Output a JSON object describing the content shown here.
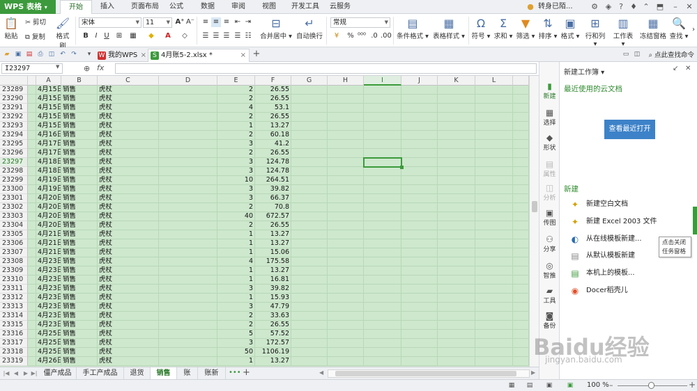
{
  "app": {
    "logo": "WPS 表格"
  },
  "menu_tabs": [
    "开始",
    "插入",
    "页面布局",
    "公式",
    "数据",
    "审阅",
    "视图",
    "开发工具",
    "云服务"
  ],
  "active_menu_tab": 0,
  "user": {
    "name": "转身已陌..."
  },
  "ribbon": {
    "paste": "粘贴",
    "cut": "剪切",
    "copy": "复制",
    "format_painter": "格式刷",
    "font_name": "宋体",
    "font_size": "11",
    "merge_center": "合并居中",
    "wrap_text": "自动换行",
    "number_format": "常规",
    "conditional_format": "条件格式",
    "table_style": "表格样式",
    "symbol": "符号",
    "sum": "求和",
    "filter": "筛选",
    "sort": "排序",
    "format": "格式",
    "row_col": "行和列",
    "worksheet": "工作表",
    "freeze": "冻结窗格",
    "find": "查找"
  },
  "doc_tabs": [
    {
      "label": "我的WPS"
    },
    {
      "label": "4月账5-2.xlsx *"
    }
  ],
  "find_command": "点此查找命令",
  "name_box": "I23297",
  "fx": "fx",
  "columns": [
    "A",
    "B",
    "C",
    "D",
    "E",
    "F",
    "G",
    "H",
    "I",
    "J",
    "K",
    "L"
  ],
  "active_column": "I",
  "rows": [
    {
      "n": "23289",
      "a": "4月15日",
      "b": "销售",
      "c": "虎杖",
      "e": "2",
      "f": "26.55"
    },
    {
      "n": "23290",
      "a": "4月15日",
      "b": "销售",
      "c": "虎杖",
      "e": "2",
      "f": "26.55"
    },
    {
      "n": "23291",
      "a": "4月15日",
      "b": "销售",
      "c": "虎杖",
      "e": "4",
      "f": "53.1"
    },
    {
      "n": "23292",
      "a": "4月15日",
      "b": "销售",
      "c": "虎杖",
      "e": "2",
      "f": "26.55"
    },
    {
      "n": "23293",
      "a": "4月15日",
      "b": "销售",
      "c": "虎杖",
      "e": "1",
      "f": "13.27"
    },
    {
      "n": "23294",
      "a": "4月16日",
      "b": "销售",
      "c": "虎杖",
      "e": "2",
      "f": "60.18"
    },
    {
      "n": "23295",
      "a": "4月17日",
      "b": "销售",
      "c": "虎杖",
      "e": "3",
      "f": "41.2"
    },
    {
      "n": "23296",
      "a": "4月17日",
      "b": "销售",
      "c": "虎杖",
      "e": "2",
      "f": "26.55"
    },
    {
      "n": "23297",
      "a": "4月18日",
      "b": "销售",
      "c": "虎杖",
      "e": "3",
      "f": "124.78"
    },
    {
      "n": "23298",
      "a": "4月18日",
      "b": "销售",
      "c": "虎杖",
      "e": "3",
      "f": "124.78"
    },
    {
      "n": "23299",
      "a": "4月19日",
      "b": "销售",
      "c": "虎杖",
      "e": "10",
      "f": "264.51"
    },
    {
      "n": "23300",
      "a": "4月19日",
      "b": "销售",
      "c": "虎杖",
      "e": "3",
      "f": "39.82"
    },
    {
      "n": "23301",
      "a": "4月20日",
      "b": "销售",
      "c": "虎杖",
      "e": "3",
      "f": "66.37"
    },
    {
      "n": "23302",
      "a": "4月20日",
      "b": "销售",
      "c": "虎杖",
      "e": "2",
      "f": "70.8"
    },
    {
      "n": "23303",
      "a": "4月20日",
      "b": "销售",
      "c": "虎杖",
      "e": "40",
      "f": "672.57"
    },
    {
      "n": "23304",
      "a": "4月20日",
      "b": "销售",
      "c": "虎杖",
      "e": "2",
      "f": "26.55"
    },
    {
      "n": "23305",
      "a": "4月21日",
      "b": "销售",
      "c": "虎杖",
      "e": "1",
      "f": "13.27"
    },
    {
      "n": "23306",
      "a": "4月21日",
      "b": "销售",
      "c": "虎杖",
      "e": "1",
      "f": "13.27"
    },
    {
      "n": "23307",
      "a": "4月21日",
      "b": "销售",
      "c": "虎杖",
      "e": "1",
      "f": "15.06"
    },
    {
      "n": "23308",
      "a": "4月23日",
      "b": "销售",
      "c": "虎杖",
      "e": "4",
      "f": "175.58"
    },
    {
      "n": "23309",
      "a": "4月23日",
      "b": "销售",
      "c": "虎杖",
      "e": "1",
      "f": "13.27"
    },
    {
      "n": "23310",
      "a": "4月23日",
      "b": "销售",
      "c": "虎杖",
      "e": "1",
      "f": "16.81"
    },
    {
      "n": "23311",
      "a": "4月23日",
      "b": "销售",
      "c": "虎杖",
      "e": "3",
      "f": "39.82"
    },
    {
      "n": "23312",
      "a": "4月23日",
      "b": "销售",
      "c": "虎杖",
      "e": "1",
      "f": "15.93"
    },
    {
      "n": "23313",
      "a": "4月23日",
      "b": "销售",
      "c": "虎杖",
      "e": "3",
      "f": "47.79"
    },
    {
      "n": "23314",
      "a": "4月23日",
      "b": "销售",
      "c": "虎杖",
      "e": "2",
      "f": "33.63"
    },
    {
      "n": "23315",
      "a": "4月23日",
      "b": "销售",
      "c": "虎杖",
      "e": "2",
      "f": "26.55"
    },
    {
      "n": "23316",
      "a": "4月25日",
      "b": "销售",
      "c": "虎杖",
      "e": "5",
      "f": "57.52"
    },
    {
      "n": "23317",
      "a": "4月25日",
      "b": "销售",
      "c": "虎杖",
      "e": "3",
      "f": "172.57"
    },
    {
      "n": "23318",
      "a": "4月25日",
      "b": "销售",
      "c": "虎杖",
      "e": "50",
      "f": "1106.19"
    },
    {
      "n": "23319",
      "a": "4月26日",
      "b": "销售",
      "c": "虎杖",
      "e": "1",
      "f": "13.27"
    }
  ],
  "active_row": "23297",
  "sheet_tabs": [
    "僵产成品",
    "手工产成品",
    "退货",
    "销售",
    "账",
    "账新"
  ],
  "active_sheet": 3,
  "sidebar": [
    {
      "label": "新建",
      "icon": "new-icon"
    },
    {
      "label": "选择",
      "icon": "select-icon"
    },
    {
      "label": "形状",
      "icon": "shape-icon"
    },
    {
      "label": "属性",
      "icon": "property-icon"
    },
    {
      "label": "分析",
      "icon": "analysis-icon"
    },
    {
      "label": "传图",
      "icon": "image-upload-icon"
    },
    {
      "label": "分享",
      "icon": "share-icon"
    },
    {
      "label": "智推",
      "icon": "recommend-icon"
    },
    {
      "label": "工具",
      "icon": "tools-icon"
    },
    {
      "label": "备份",
      "icon": "backup-icon"
    }
  ],
  "taskpane": {
    "header": "新建工作簿",
    "recent_title": "最近使用的云文档",
    "open_recent": "查看最近打开",
    "new_title": "新建",
    "items": [
      "新建空白文档",
      "新建 Excel 2003 文件",
      "从在线模板新建...",
      "从默认模板新建",
      "本机上的模板...",
      "Docer稻壳儿"
    ]
  },
  "tooltip": {
    "line1": "点击关闭",
    "line2": "任务窗格"
  },
  "zoom": "100 %",
  "watermark": {
    "main": "Baidu经验",
    "sub": "jingyan.baidu.com"
  },
  "colors": {
    "brand": "#3c9a3c",
    "grid_bg": "#cde8cd",
    "accent_blue": "#3d82c8"
  }
}
